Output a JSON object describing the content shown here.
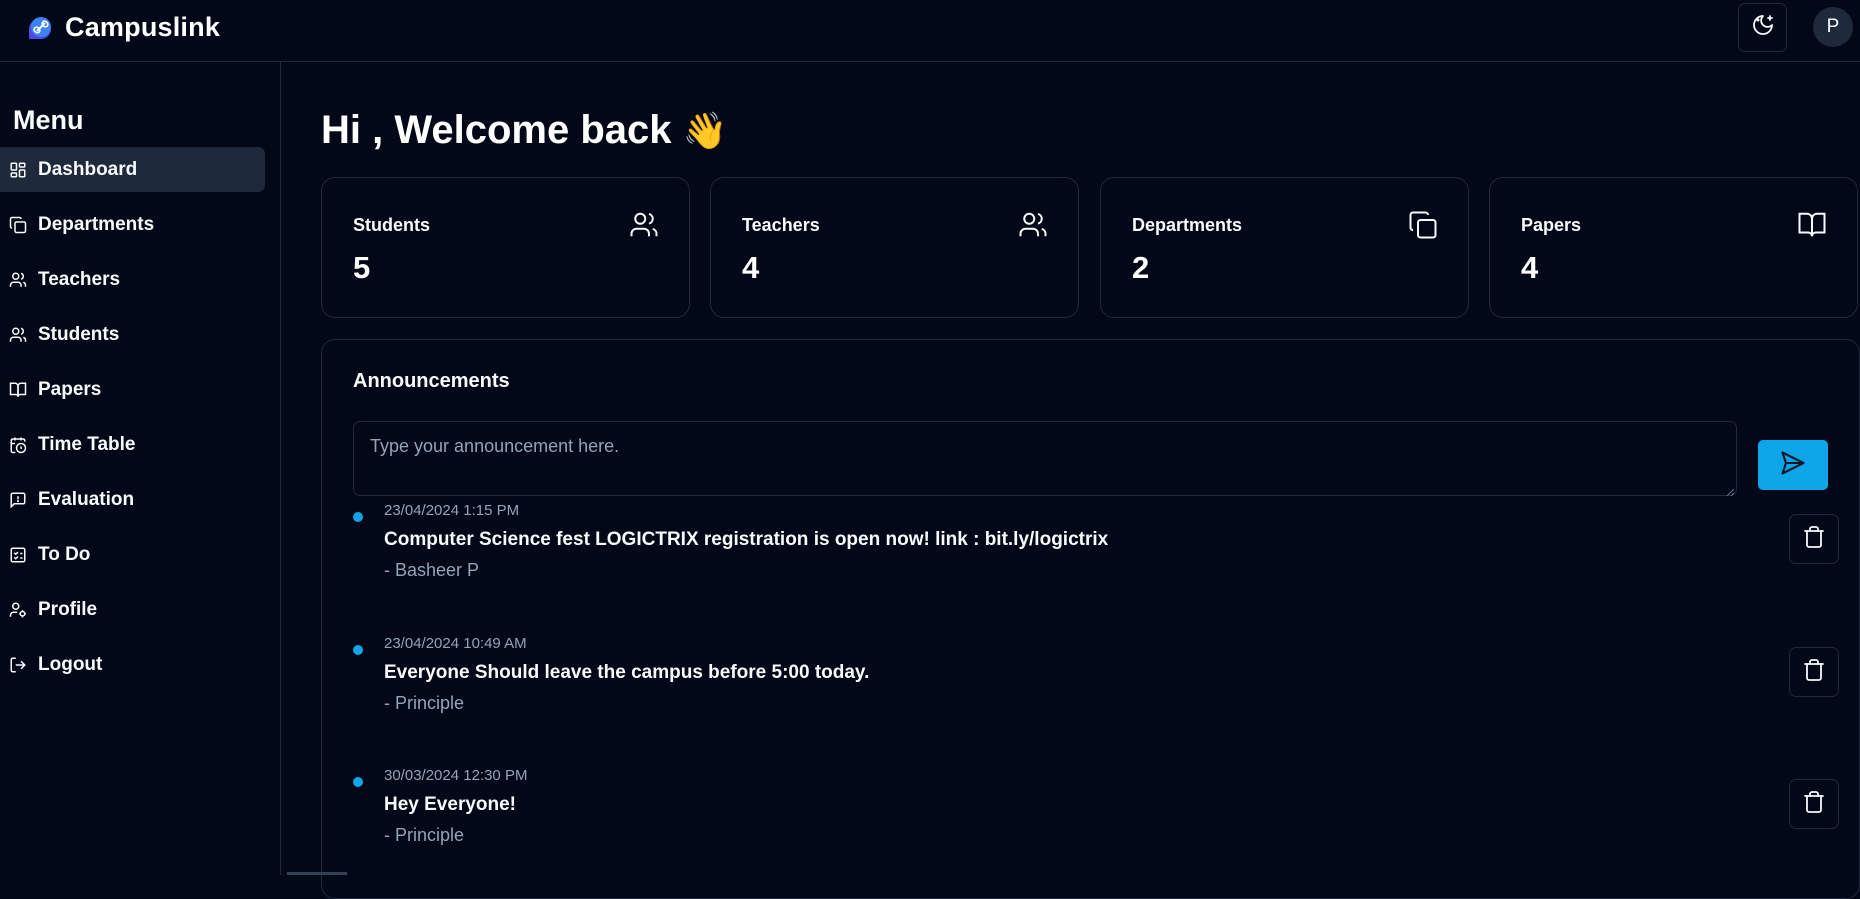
{
  "app": {
    "name": "Campuslink"
  },
  "header": {
    "avatar_initial": "P",
    "theme_toggle_icon": "moon-stars-icon"
  },
  "sidebar": {
    "title": "Menu",
    "items": [
      {
        "label": "Dashboard",
        "icon": "dashboard-icon",
        "active": true
      },
      {
        "label": "Departments",
        "icon": "copy-icon",
        "active": false
      },
      {
        "label": "Teachers",
        "icon": "users-icon",
        "active": false
      },
      {
        "label": "Students",
        "icon": "users-icon",
        "active": false
      },
      {
        "label": "Papers",
        "icon": "book-open-icon",
        "active": false
      },
      {
        "label": "Time Table",
        "icon": "calendar-clock-icon",
        "active": false
      },
      {
        "label": "Evaluation",
        "icon": "message-square-icon",
        "active": false
      },
      {
        "label": "To Do",
        "icon": "checklist-icon",
        "active": false
      },
      {
        "label": "Profile",
        "icon": "user-cog-icon",
        "active": false
      },
      {
        "label": "Logout",
        "icon": "logout-icon",
        "active": false
      }
    ]
  },
  "main": {
    "greeting": "Hi , Welcome back",
    "greeting_emoji": "👋",
    "stats": [
      {
        "label": "Students",
        "value": "5",
        "icon": "users-icon"
      },
      {
        "label": "Teachers",
        "value": "4",
        "icon": "users-icon"
      },
      {
        "label": "Departments",
        "value": "2",
        "icon": "copy-icon"
      },
      {
        "label": "Papers",
        "value": "4",
        "icon": "book-open-icon"
      }
    ],
    "announcements": {
      "title": "Announcements",
      "placeholder": "Type your announcement here.",
      "items": [
        {
          "time": "23/04/2024 1:15 PM",
          "text": "Computer Science fest LOGICTRIX registration is open now! link : bit.ly/logictrix",
          "author": "- Basheer P"
        },
        {
          "time": "23/04/2024 10:49 AM",
          "text": "Everyone Should leave the campus before 5:00 today.",
          "author": "- Principle"
        },
        {
          "time": "30/03/2024 12:30 PM",
          "text": "Hey Everyone!",
          "author": "- Principle"
        }
      ]
    }
  },
  "colors": {
    "background": "#020817",
    "border": "#1e293b",
    "accent": "#0ea5e9",
    "muted_text": "#94a3b8"
  }
}
